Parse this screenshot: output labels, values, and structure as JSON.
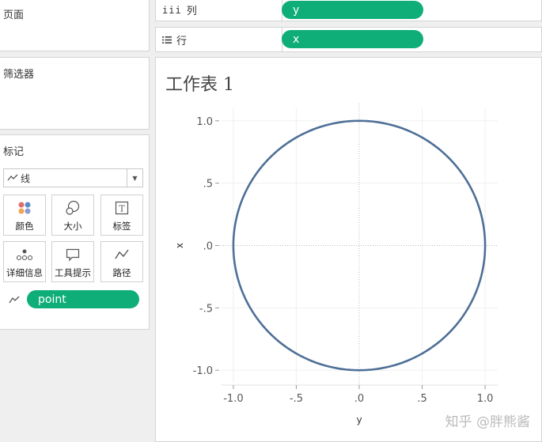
{
  "pages": {
    "title": "页面"
  },
  "filters": {
    "title": "筛选器"
  },
  "marks": {
    "title": "标记",
    "mark_type": "线",
    "buttons": [
      {
        "label": "颜色",
        "icon": "color-icon"
      },
      {
        "label": "大小",
        "icon": "size-icon"
      },
      {
        "label": "标签",
        "icon": "label-icon"
      },
      {
        "label": "详细信息",
        "icon": "detail-icon"
      },
      {
        "label": "工具提示",
        "icon": "tooltip-icon"
      },
      {
        "label": "路径",
        "icon": "path-icon"
      }
    ],
    "path_field": "point"
  },
  "shelves": {
    "columns": {
      "label": "列",
      "field": "y"
    },
    "rows": {
      "label": "行",
      "field": "x"
    }
  },
  "worksheet": {
    "title": "工作表 1"
  },
  "watermark": "知乎 @胖熊酱",
  "colors": {
    "pill": "#0fae78",
    "line": "#4e6f96"
  },
  "chart_data": {
    "type": "line",
    "xlabel": "y",
    "ylabel": "x",
    "xlim": [
      -1.1,
      1.1
    ],
    "ylim": [
      -1.1,
      1.1
    ],
    "x_ticks": [
      -1.0,
      -0.5,
      0.0,
      0.5,
      1.0
    ],
    "x_tick_labels": [
      "-1.0",
      "-.5",
      ".0",
      ".5",
      "1.0"
    ],
    "y_ticks": [
      1.0,
      0.5,
      0.0,
      -0.5,
      -1.0
    ],
    "y_tick_labels": [
      "1.0",
      ".5",
      ".0",
      "-.5",
      "-1.0"
    ],
    "series": [
      {
        "shape": "circle",
        "center": [
          0,
          0
        ],
        "radius": 1.0
      }
    ]
  }
}
